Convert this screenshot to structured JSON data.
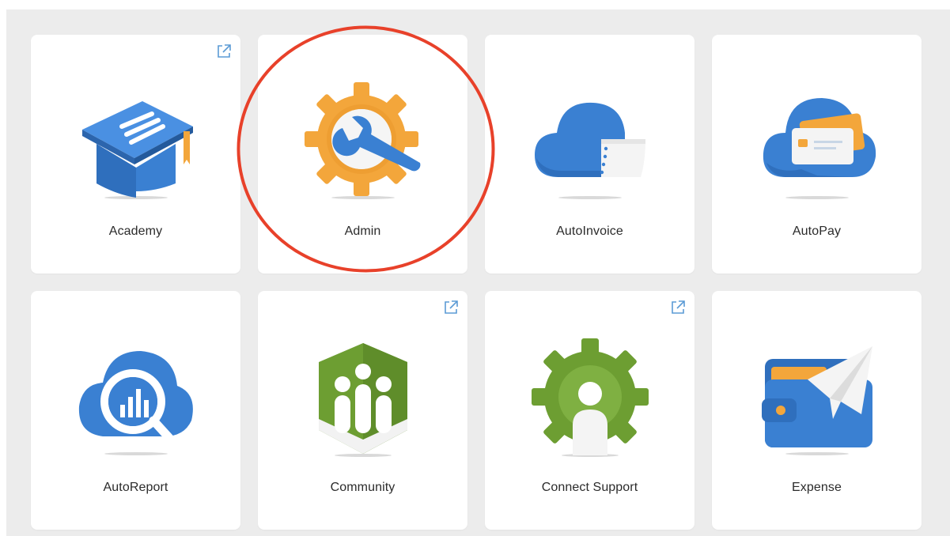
{
  "apps": [
    {
      "label": "Academy",
      "icon": "graduation-cap-icon",
      "external": true
    },
    {
      "label": "Admin",
      "icon": "gear-wrench-icon",
      "external": false,
      "highlighted": true
    },
    {
      "label": "AutoInvoice",
      "icon": "cloud-invoice-icon",
      "external": false
    },
    {
      "label": "AutoPay",
      "icon": "cloud-card-icon",
      "external": false
    },
    {
      "label": "AutoReport",
      "icon": "cloud-chart-magnifier-icon",
      "external": false
    },
    {
      "label": "Community",
      "icon": "people-hexagon-icon",
      "external": true
    },
    {
      "label": "Connect Support",
      "icon": "gear-person-icon",
      "external": true
    },
    {
      "label": "Expense",
      "icon": "wallet-paper-plane-icon",
      "external": false
    }
  ],
  "colors": {
    "background": "#ececec",
    "tile": "#ffffff",
    "blue": "#3a80d2",
    "orange": "#f3a63b",
    "green": "#6d9e32",
    "highlight_ring": "#e8412a",
    "external_icon": "#5b9bd5"
  }
}
